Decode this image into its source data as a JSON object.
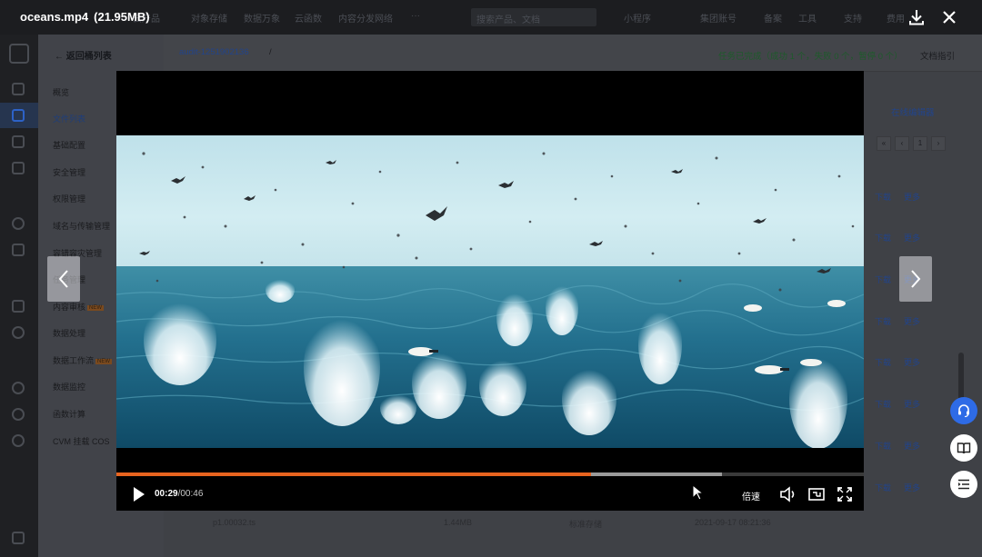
{
  "viewer": {
    "file_name": "oceans.mp4",
    "file_size": "(21.95MB)",
    "download_icon": "download-icon",
    "close_icon": "close-icon"
  },
  "player": {
    "current_time": "00:29",
    "total_time": "00:46",
    "time_separator": "/",
    "played_fraction": 0.635,
    "buffered_fraction": 0.81,
    "speed_label": "倍速",
    "controls": [
      "play-icon",
      "volume-icon",
      "picture-in-picture-icon",
      "fullscreen-icon"
    ]
  },
  "background_console": {
    "top_nav": [
      "云产品",
      "对象存储",
      "数据万象",
      "云函数",
      "内容分发网络",
      "···",
      "小程序",
      "集团账号",
      "备案",
      "工具",
      "支持",
      "费用"
    ],
    "search_placeholder": "搜索产品、文档",
    "back_label": "返回桶列表",
    "breadcrumb_bucket": "audit-1251902136",
    "breadcrumb_sep": "/",
    "task_status": "任务已完成（成功 1 个，失败 0 个，暂停 0 个）",
    "doc_guide": "文档指引",
    "online_editor": "在线编辑器",
    "page_number": "1",
    "sidebar_items": [
      "概览",
      "文件列表",
      "基础配置",
      "安全管理",
      "权限管理",
      "域名与传输管理",
      "容错容灾管理",
      "任务管理",
      "内容审核",
      "数据处理",
      "数据工作流",
      "数据监控",
      "函数计算",
      "CVM 挂载 COS"
    ],
    "new_badge": "NEW",
    "row_actions": [
      "下载",
      "更多"
    ],
    "bottom_row": {
      "name": "p1.00032.ts",
      "size": "1.44MB",
      "storage": "标准存储",
      "date": "2021-09-17 08:21:36"
    }
  },
  "floating": [
    "headset-icon",
    "book-icon",
    "list-icon"
  ],
  "colors": {
    "accent": "#e8641f",
    "buffered": "#9a9a9a",
    "float_blue": "#2e6be6"
  }
}
